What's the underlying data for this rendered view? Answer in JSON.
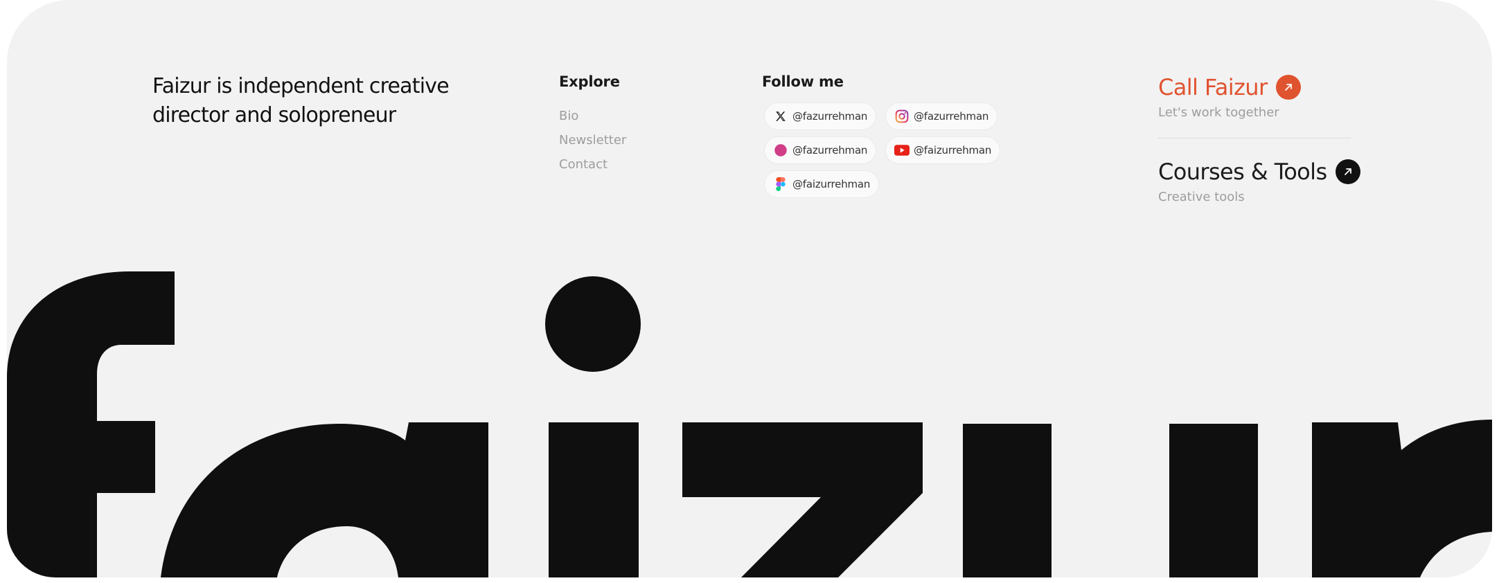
{
  "intro": {
    "text": "Faizur is independent creative director and solopreneur"
  },
  "explore": {
    "title": "Explore",
    "items": [
      "Bio",
      "Newsletter",
      "Contact"
    ]
  },
  "follow": {
    "title": "Follow me",
    "links": [
      {
        "platform": "x-icon",
        "handle": "@fazurrehman"
      },
      {
        "platform": "instagram-icon",
        "handle": "@fazurrehman"
      },
      {
        "platform": "dribbble-icon",
        "handle": "@fazurrehman"
      },
      {
        "platform": "youtube-icon",
        "handle": "@faizurrehman"
      },
      {
        "platform": "figma-icon",
        "handle": "@faizurrehman"
      }
    ]
  },
  "cta": {
    "call": {
      "label": "Call Faizur",
      "sub": "Let's work together"
    },
    "courses": {
      "label": "Courses & Tools",
      "sub": "Creative tools"
    }
  },
  "colors": {
    "background": "#f2f2f2",
    "accent": "#e0532f",
    "ink": "#111111",
    "muted": "#9d9d9d"
  }
}
